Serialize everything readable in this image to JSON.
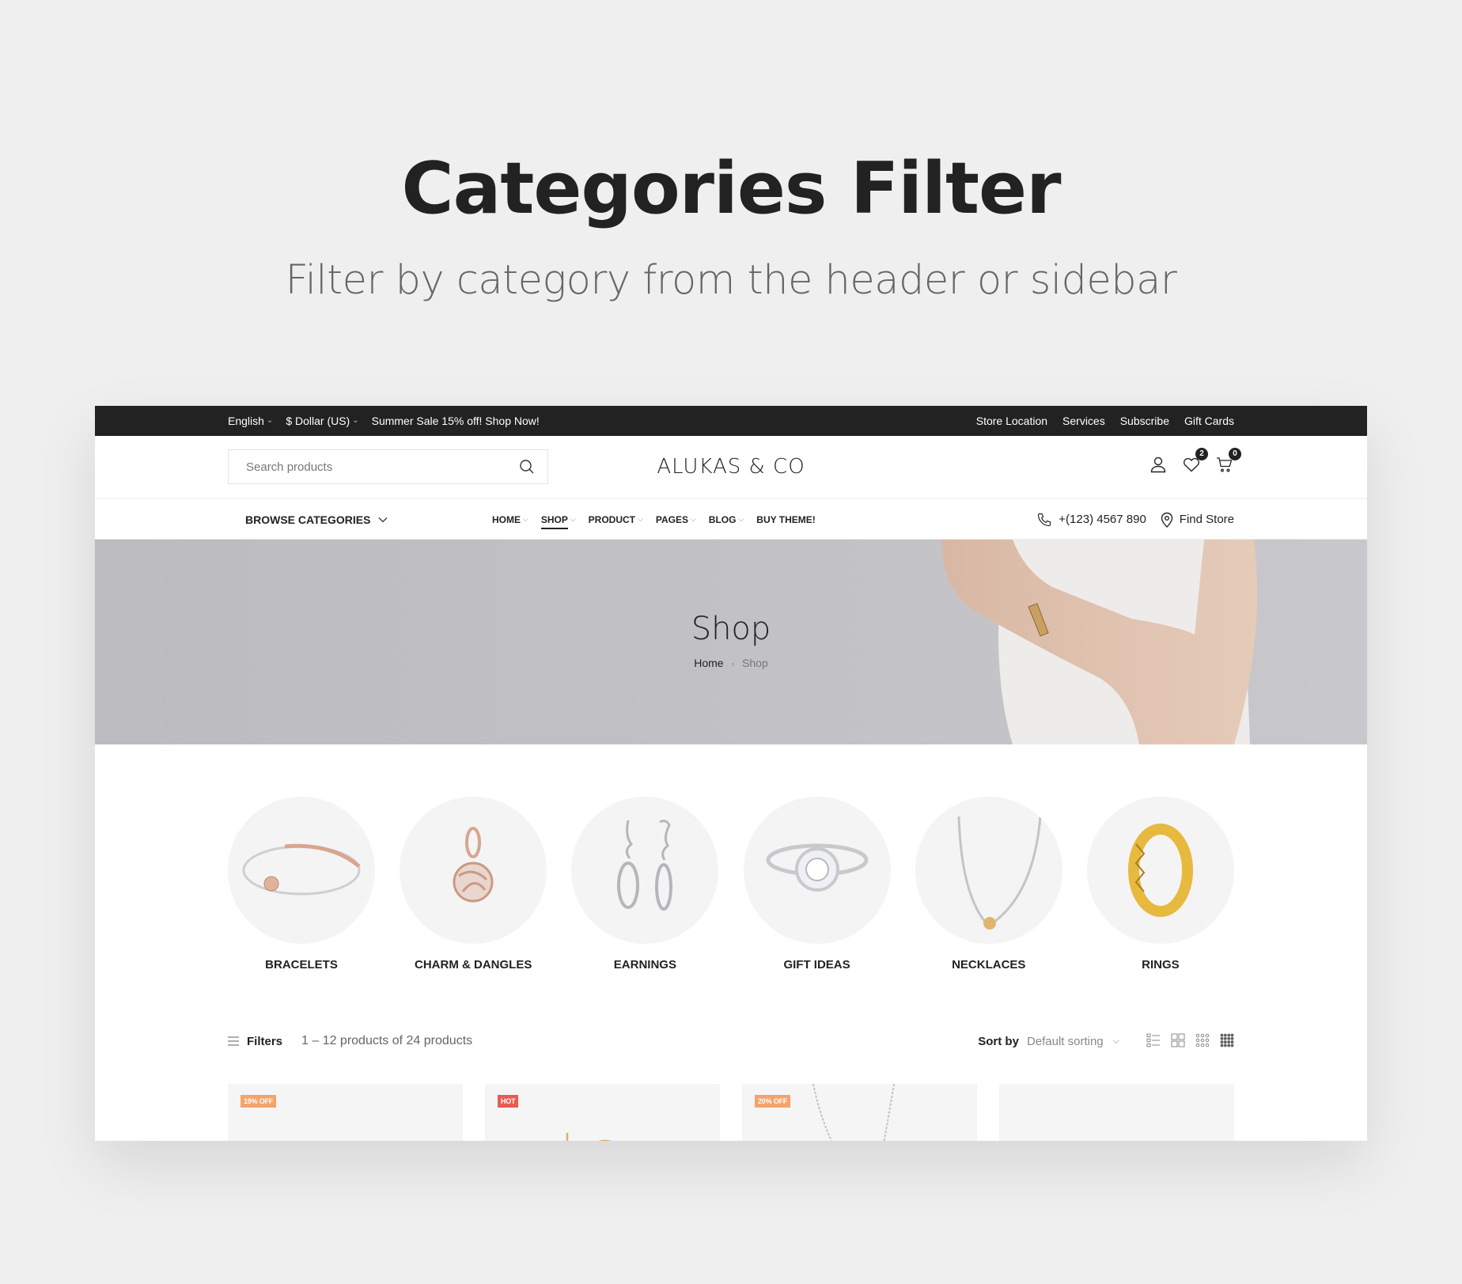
{
  "hero": {
    "title": "Categories Filter",
    "subtitle": "Filter by category from the header or sidebar"
  },
  "topbar": {
    "language": "English",
    "currency": "$ Dollar (US)",
    "promo": "Summer Sale 15% off! Shop Now!",
    "links": [
      "Store Location",
      "Services",
      "Subscribe",
      "Gift Cards"
    ]
  },
  "header": {
    "search_placeholder": "Search products",
    "search_icon": "search-icon",
    "logo": "ALUKAS & CO",
    "wishlist_count": "2",
    "cart_count": "0",
    "icons": [
      "user-icon",
      "heart-icon",
      "cart-icon"
    ]
  },
  "nav": {
    "browse_label": "BROWSE CATEGORIES",
    "menu": [
      {
        "label": "HOME",
        "has_dropdown": true
      },
      {
        "label": "SHOP",
        "has_dropdown": true,
        "active": true
      },
      {
        "label": "PRODUCT",
        "has_dropdown": true
      },
      {
        "label": "PAGES",
        "has_dropdown": true
      },
      {
        "label": "BLOG",
        "has_dropdown": true
      },
      {
        "label": "BUY THEME!",
        "has_dropdown": false
      }
    ],
    "phone": "+(123) 4567 890",
    "find_store": "Find Store"
  },
  "banner": {
    "title": "Shop",
    "breadcrumb": [
      "Home",
      "Shop"
    ]
  },
  "categories": [
    {
      "name": "BRACELETS"
    },
    {
      "name": "CHARM & DANGLES"
    },
    {
      "name": "EARNINGS"
    },
    {
      "name": "GIFT IDEAS"
    },
    {
      "name": "NECKLACES"
    },
    {
      "name": "RINGS"
    }
  ],
  "toolbar": {
    "filters_label": "Filters",
    "result_count": "1 – 12 products of 24 products",
    "sort_label": "Sort by",
    "sort_value": "Default sorting",
    "view_modes": [
      "list-view",
      "grid-2",
      "grid-3",
      "grid-4"
    ]
  },
  "products": [
    {
      "badge": "19% OFF",
      "badge_color": "#f4a46a"
    },
    {
      "badge": "HOT",
      "badge_color": "#ea5b50"
    },
    {
      "badge": "20% OFF",
      "badge_color": "#f4a46a"
    },
    {
      "badge": "",
      "badge_color": ""
    }
  ],
  "colors": {
    "topbar_bg": "#222222",
    "page_bg": "#efefef",
    "circle_bg": "#f4f4f4",
    "sale_badge": "#f4a46a",
    "hot_badge": "#ea5b50"
  }
}
